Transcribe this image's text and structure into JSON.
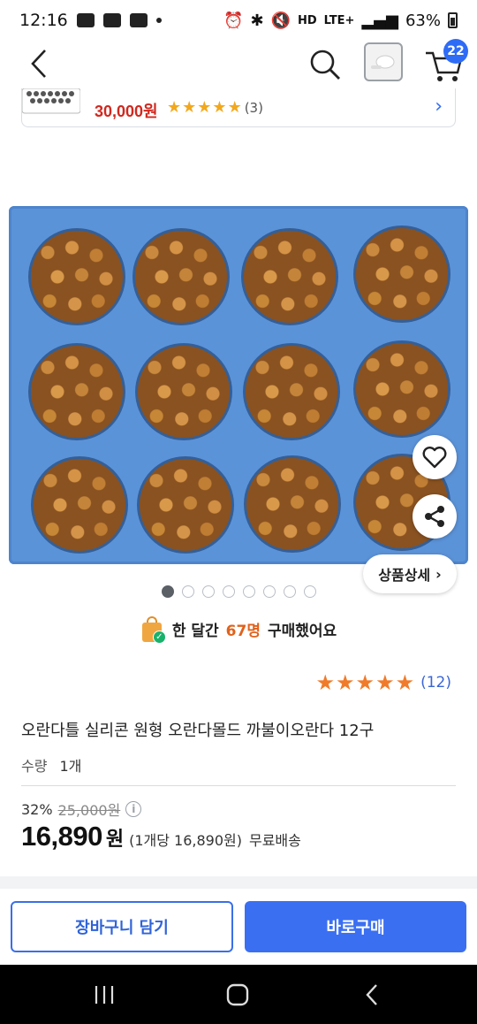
{
  "status_bar": {
    "time": "12:16",
    "network": "LTE+",
    "battery": "63%",
    "hd_label": "HD"
  },
  "header": {
    "cart_badge": "22"
  },
  "related": {
    "price": "30,000원",
    "review_count": "(3)"
  },
  "gallery": {
    "detail_button": "상품상세",
    "dot_count": 8,
    "active_index": 0
  },
  "purchase": {
    "prefix": "한 달간",
    "count": "67명",
    "suffix": "구매했어요"
  },
  "rating": {
    "stars": 5,
    "review_count": "(12)"
  },
  "product": {
    "title": "오란다틀 실리콘 원형 오란다몰드 까불이오란다 12구",
    "qty_label": "수량",
    "qty_value": "1개",
    "discount": "32%",
    "original_price": "25,000원",
    "sale_price": "16,890",
    "won": "원",
    "unit_price": "(1개당 16,890원)",
    "shipping": "무료배송"
  },
  "actions": {
    "add_to_cart": "장바구니 담기",
    "buy_now": "바로구매"
  },
  "colors": {
    "accent_blue": "#3a6ff2",
    "price_red": "#d0281f",
    "star_orange": "#f07b2a",
    "highlight_orange": "#e0621c"
  }
}
